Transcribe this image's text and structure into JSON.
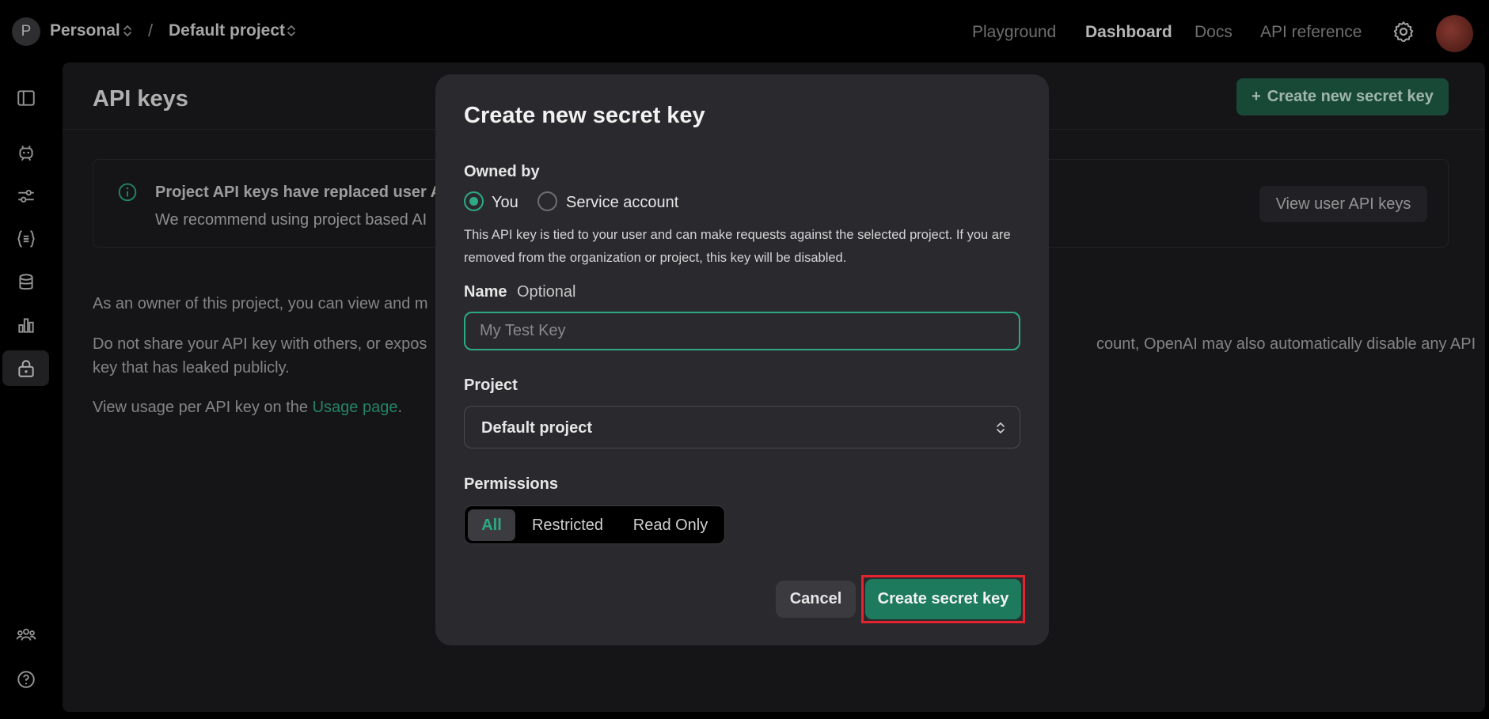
{
  "topbar": {
    "org_initial": "P",
    "org_name": "Personal",
    "separator": "/",
    "project_name": "Default project",
    "nav": [
      {
        "label": "Playground"
      },
      {
        "label": "Dashboard",
        "active": true
      },
      {
        "label": "Docs"
      },
      {
        "label": "API reference"
      }
    ]
  },
  "sidebar": {
    "items": [
      {
        "icon": "sidebar-toggle-icon"
      },
      {
        "icon": "assistants-icon"
      },
      {
        "icon": "fine-tuning-icon"
      },
      {
        "icon": "batches-icon"
      },
      {
        "icon": "storage-icon"
      },
      {
        "icon": "usage-icon"
      },
      {
        "icon": "api-keys-icon",
        "active": true
      },
      {
        "icon": "team-icon"
      },
      {
        "icon": "help-icon"
      }
    ]
  },
  "page": {
    "title": "API keys",
    "create_button": "Create new secret key",
    "notice_title": "Project API keys have replaced user A",
    "notice_body": "We recommend using project based AI",
    "view_user_keys": "View user API keys",
    "para1": "As an owner of this project, you can view and m",
    "para2_left": "Do not share your API key with others, or expos",
    "para2_right": "count, OpenAI may also automatically disable any API",
    "para2_line2": "key that has leaked publicly.",
    "para3_prefix": "View usage per API key on the ",
    "para3_link": "Usage page",
    "para3_suffix": "."
  },
  "modal": {
    "title": "Create new secret key",
    "owned_by_label": "Owned by",
    "owner_options": [
      {
        "label": "You",
        "selected": true
      },
      {
        "label": "Service account",
        "selected": false
      }
    ],
    "help_text": "This API key is tied to your user and can make requests against the selected project. If you are removed from the organization or project, this key will be disabled.",
    "name_label": "Name",
    "name_optional": "Optional",
    "name_placeholder": "My Test Key",
    "name_value": "",
    "project_label": "Project",
    "project_value": "Default project",
    "permissions_label": "Permissions",
    "permissions": [
      {
        "label": "All",
        "selected": true
      },
      {
        "label": "Restricted",
        "selected": false
      },
      {
        "label": "Read Only",
        "selected": false
      }
    ],
    "cancel": "Cancel",
    "submit": "Create secret key"
  },
  "colors": {
    "accent": "#2ea981",
    "button_green": "#1d7a5c",
    "highlight_outline": "#e5232e",
    "modal_bg": "#2a2a2e",
    "panel_bg": "#1b1b1e"
  }
}
